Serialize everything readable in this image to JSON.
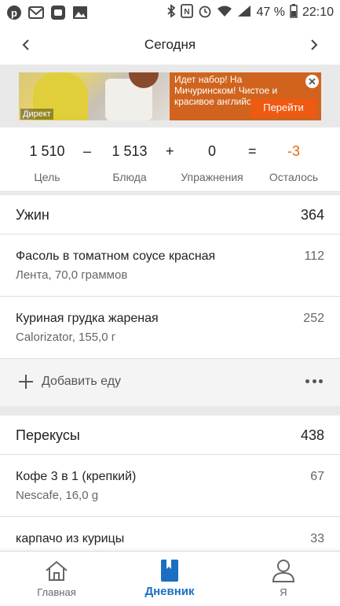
{
  "status_bar": {
    "battery_percent": "47 %",
    "time": "22:10",
    "left_icons": [
      "pinterest-icon",
      "gmail-icon",
      "app-icon",
      "gallery-icon"
    ],
    "right_icons": [
      "bluetooth-icon",
      "nfc-icon",
      "alarm-icon",
      "wifi-icon",
      "signal-icon",
      "battery-icon"
    ]
  },
  "header": {
    "title": "Сегодня",
    "prev_icon": "chevron-left-icon",
    "next_icon": "chevron-right-icon"
  },
  "ad": {
    "label": "Директ",
    "text": "Идет набор! На Мичуринском! Чистое и красивое английск…",
    "button": "Перейти",
    "close_icon": "close-icon",
    "colors": {
      "background": "#d0641e",
      "button": "#ee5a12"
    }
  },
  "summary": {
    "goal_value": "1 510",
    "goal_label": "Цель",
    "op_minus": "–",
    "food_value": "1 513",
    "food_label": "Блюда",
    "op_plus": "+",
    "exercise_value": "0",
    "exercise_label": "Упражнения",
    "op_equals": "=",
    "remaining_value": "-3",
    "remaining_label": "Осталось",
    "remaining_color": "#e06a12"
  },
  "dinner": {
    "title": "Ужин",
    "kcal": "364",
    "items": [
      {
        "name": "Фасоль в томатном соусе красная",
        "desc": "Лента, 70,0 граммов",
        "kcal": "112"
      },
      {
        "name": "Куриная грудка жареная",
        "desc": "Calorizator, 155,0 г",
        "kcal": "252"
      }
    ],
    "add_label": "Добавить еду"
  },
  "snacks": {
    "title": "Перекусы",
    "kcal": "438",
    "items": [
      {
        "name": "Кофе 3 в 1 (крепкий)",
        "desc": "Nescafe, 16,0 g",
        "kcal": "67"
      },
      {
        "name": "карпачо из курицы",
        "desc": "",
        "kcal": "33"
      }
    ]
  },
  "bottom_nav": {
    "accent": "#1a6fc2",
    "tabs": [
      {
        "label": "Главная",
        "icon": "home-icon"
      },
      {
        "label": "Дневник",
        "icon": "diary-icon"
      },
      {
        "label": "Я",
        "icon": "profile-icon"
      }
    ]
  }
}
